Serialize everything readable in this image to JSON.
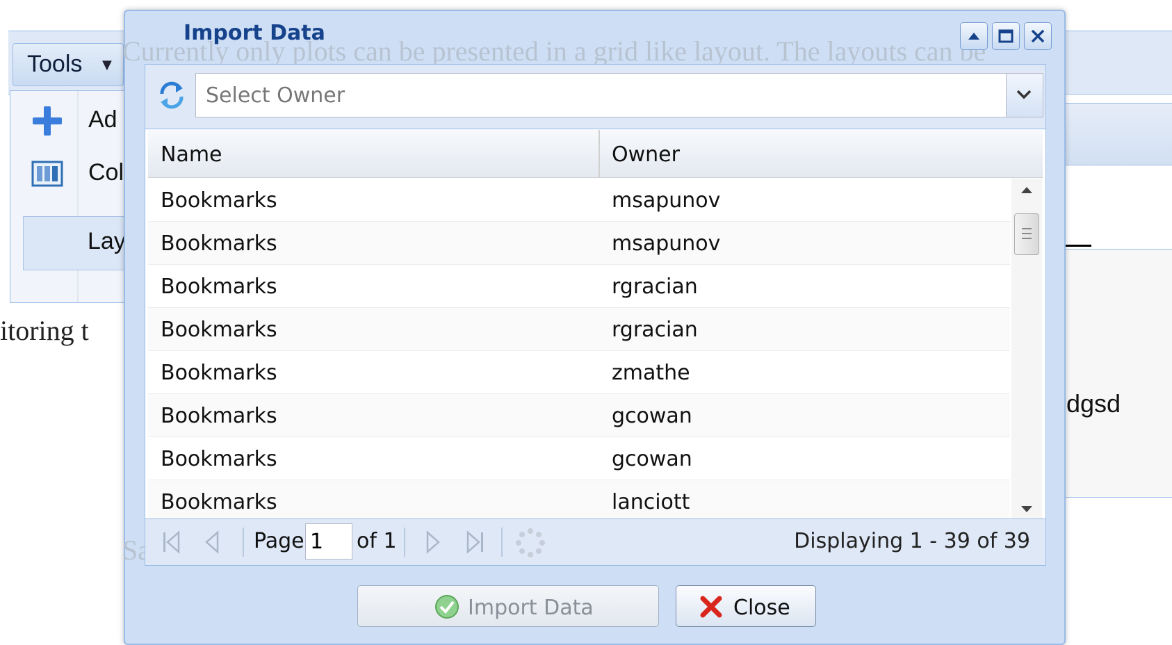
{
  "background": {
    "tools_menu": {
      "label": "Tools",
      "items": [
        {
          "icon": "plus-icon",
          "label": "Ad"
        },
        {
          "icon": "columns-icon",
          "label": "Col"
        }
      ],
      "layout_item": "Lay"
    },
    "text_fragments": {
      "monitoring": "itoring t",
      "faded_top": "Currently only plots can be presented in a grid like layout. The layouts can be",
      "faded_bottom": "Save -> Save as new layout",
      "right_item": "dgsd"
    }
  },
  "dialog": {
    "title": "Import Data",
    "owner_select": {
      "placeholder": "Select Owner"
    },
    "grid": {
      "columns": [
        "Name",
        "Owner"
      ],
      "rows": [
        {
          "name": "Bookmarks",
          "owner": "msapunov"
        },
        {
          "name": "Bookmarks",
          "owner": "msapunov"
        },
        {
          "name": "Bookmarks",
          "owner": "rgracian"
        },
        {
          "name": "Bookmarks",
          "owner": "rgracian"
        },
        {
          "name": "Bookmarks",
          "owner": "zmathe"
        },
        {
          "name": "Bookmarks",
          "owner": "gcowan"
        },
        {
          "name": "Bookmarks",
          "owner": "gcowan"
        },
        {
          "name": "Bookmarks",
          "owner": "lanciott"
        }
      ]
    },
    "paging": {
      "page_label": "Page",
      "page_value": "1",
      "of_label": "of 1",
      "display_text": "Displaying 1 - 39 of 39"
    },
    "buttons": {
      "import_label": "Import Data",
      "close_label": "Close"
    }
  },
  "colors": {
    "title": "#15428b",
    "frame": "#cedff5",
    "border": "#99bbe8",
    "close_x": "#d9261c",
    "ok_green": "#3da53d"
  }
}
